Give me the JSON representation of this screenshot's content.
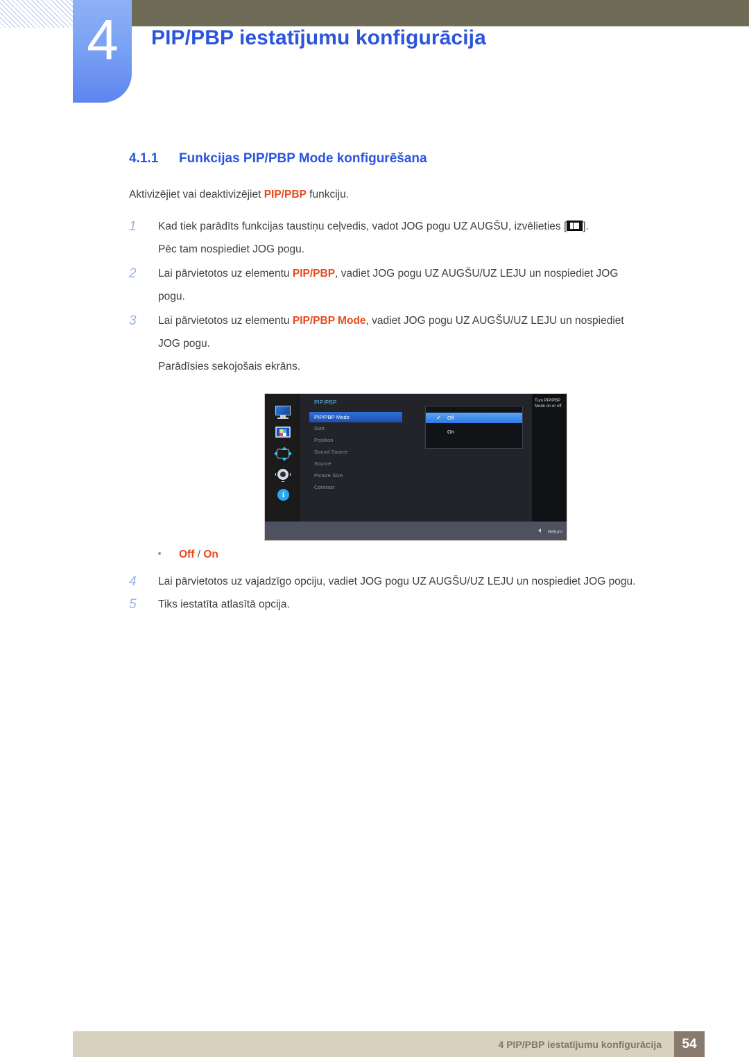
{
  "header": {
    "chapter_number": "4",
    "chapter_title": "PIP/PBP iestatījumu konfigurācija",
    "accent_blue": "#2b55dd",
    "badge_blue": "#7aa2f4",
    "olive": "#6e6b56"
  },
  "section": {
    "number": "4.1.1",
    "title": "Funkcijas PIP/PBP Mode konfigurēšana",
    "intro_before": "Aktivizējiet vai deaktivizējiet ",
    "intro_keyword": "PIP/PBP",
    "intro_after": " funkciju.",
    "keyword_color": "#e8491e"
  },
  "steps": [
    {
      "index": "1",
      "line1_before": "Kad tiek parādīts funkcijas taustiņu ceļvedis, vadot JOG pogu UZ AUGŠU, izvēlieties [",
      "line1_after": "].",
      "line2": "Pēc tam nospiediet JOG pogu."
    },
    {
      "index": "2",
      "before": "Lai pārvietotos uz elementu ",
      "keyword": "PIP/PBP",
      "after": ", vadiet JOG pogu UZ AUGŠU/UZ LEJU un nospiediet JOG",
      "line2": "pogu."
    },
    {
      "index": "3",
      "before": "Lai pārvietotos uz elementu ",
      "keyword": "PIP/PBP Mode",
      "after": ", vadiet JOG pogu UZ AUGŠU/UZ LEJU un nospiediet",
      "line2": "JOG pogu.",
      "line3": "Parādīsies sekojošais ekrāns."
    },
    {
      "index": "4",
      "text": "Lai pārvietotos uz vajadzīgo opciju, vadiet JOG pogu UZ AUGŠU/UZ LEJU un nospiediet JOG pogu."
    },
    {
      "index": "5",
      "text": "Tiks iestatīta atlasītā opcija."
    }
  ],
  "bullet": {
    "option_off": "Off",
    "separator": " / ",
    "option_on": "On"
  },
  "osd": {
    "rail_icons": [
      "monitor-icon",
      "pip-pbp-icon",
      "position-arrows-icon",
      "gear-icon",
      "info-icon"
    ],
    "panel_title": "PIP/PBP",
    "menu_items": [
      "PIP/PBP Mode",
      "Size",
      "Position",
      "Sound Source",
      "Source",
      "Picture Size",
      "Contrast"
    ],
    "dropdown": {
      "options": [
        "Off",
        "On"
      ],
      "selected": "Off",
      "check_glyph": "✔"
    },
    "help_text": "Turn PIP/PBP Mode on or off.",
    "return_label": "Return",
    "highlight_blue": "#2f6fd8",
    "title_color": "#57b7e0"
  },
  "footer": {
    "text": "4 PIP/PBP iestatījumu konfigurācija",
    "page": "54",
    "bar_color": "#d7d1bd",
    "page_box_color": "#887a6d"
  }
}
